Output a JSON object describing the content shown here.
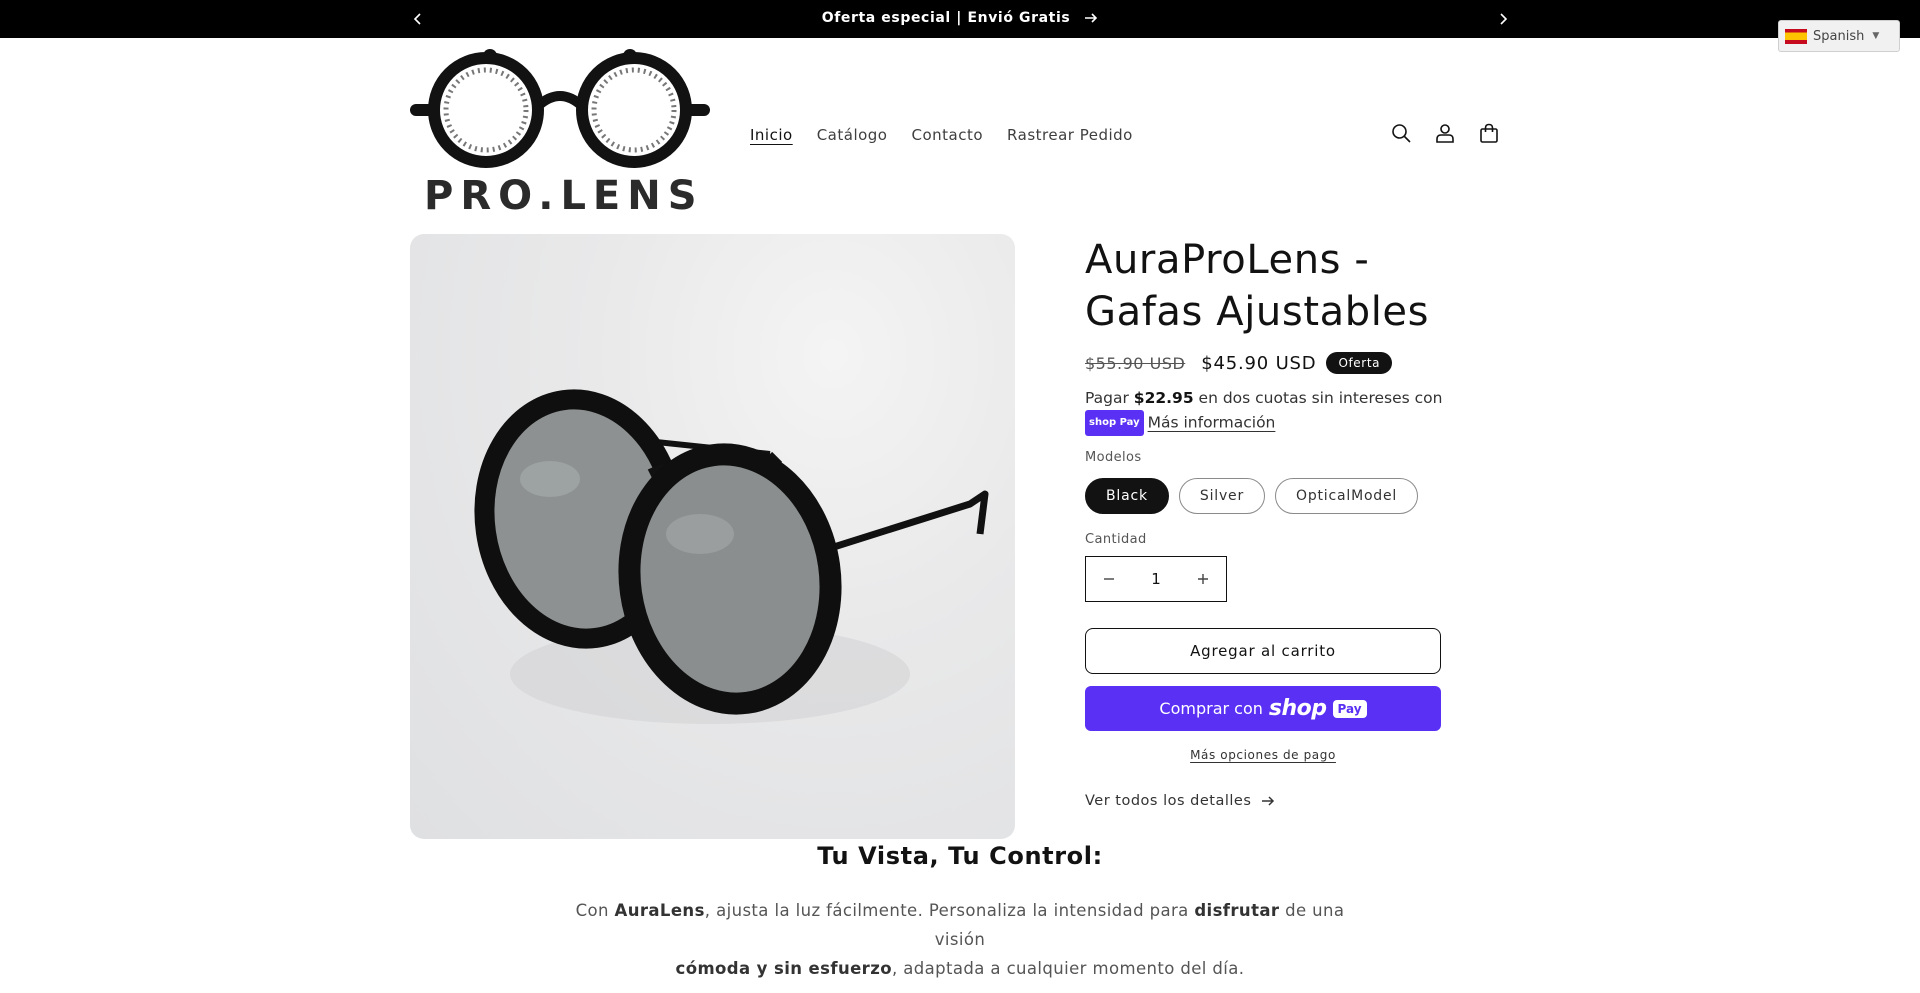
{
  "announcement": {
    "text": "Oferta especial | Envió Gratis"
  },
  "language": {
    "selected": "Spanish",
    "flag_icon": "spain-flag-icon"
  },
  "brand": {
    "name": "PRO.LENS"
  },
  "nav": {
    "items": [
      "Inicio",
      "Catálogo",
      "Contacto",
      "Rastrear Pedido"
    ],
    "active_index": 0
  },
  "header_icons": [
    "search-icon",
    "account-icon",
    "cart-icon"
  ],
  "product": {
    "title": "AuraProLens - Gafas Ajustables",
    "price_compare": "$55.90 USD",
    "price": "$45.90 USD",
    "badge": "Oferta",
    "installments": {
      "prefix": "Pagar ",
      "amount": "$22.95",
      "suffix": " en dos cuotas sin intereses con",
      "shoppay_label": "shop Pay",
      "link": "Más información"
    },
    "variant_label": "Modelos",
    "variants": [
      "Black",
      "Silver",
      "OpticalModel"
    ],
    "selected_variant": "Black",
    "quantity_label": "Cantidad",
    "quantity": "1",
    "add_to_cart": "Agregar al carrito",
    "buy_with": "Comprar con",
    "buy_shop": "shop",
    "buy_pay": "Pay",
    "more_payment": "Más opciones de pago",
    "view_details": "Ver todos los detalles"
  },
  "section": {
    "heading": "Tu Vista, Tu Control:",
    "desc_parts": {
      "p1": "Con ",
      "b1": "AuraLens",
      "p2": ", ajusta la luz fácilmente. Personaliza la intensidad para ",
      "b2": "disfrutar",
      "p3": " de una visión ",
      "b3": "cómoda y sin esfuerzo",
      "p4": ", adaptada a cualquier momento del día."
    }
  },
  "colors": {
    "accent_shoppay": "#5a31f4",
    "text": "#121212",
    "announcement_bg": "#000000"
  }
}
